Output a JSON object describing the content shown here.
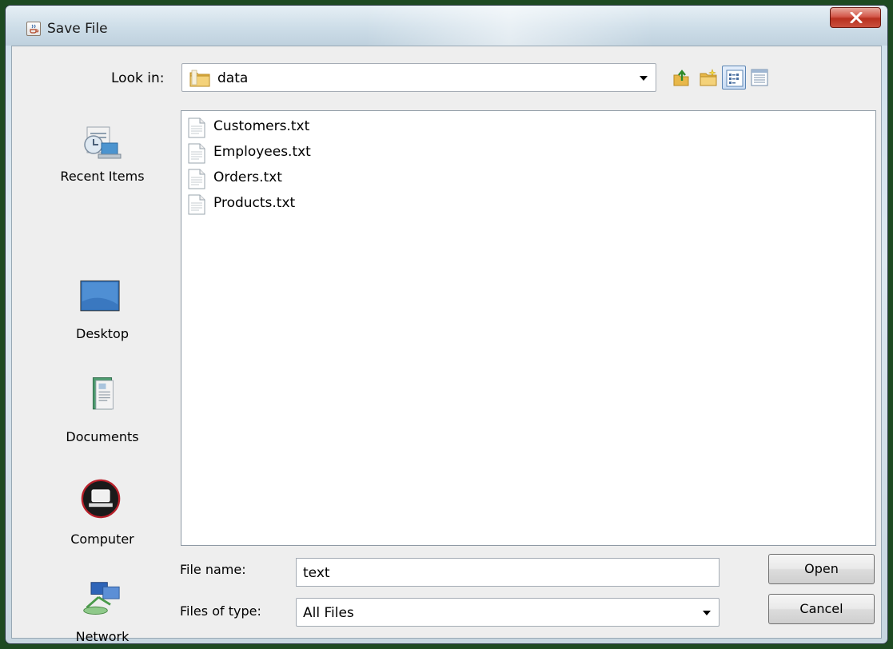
{
  "window": {
    "title": "Save File",
    "title_icon": "java-cup-icon",
    "close_icon": "close-x-icon"
  },
  "toolbar": {
    "look_in_label": "Look in:",
    "look_in_value": "data",
    "icons": [
      "up-one-level-icon",
      "create-new-folder-icon",
      "list-view-icon",
      "details-view-icon"
    ]
  },
  "places": [
    {
      "label": "Recent Items",
      "icon": "recent-items-icon"
    },
    {
      "label": "Desktop",
      "icon": "desktop-icon"
    },
    {
      "label": "Documents",
      "icon": "documents-icon"
    },
    {
      "label": "Computer",
      "icon": "computer-icon"
    },
    {
      "label": "Network",
      "icon": "network-icon"
    }
  ],
  "files": [
    {
      "name": "Customers.txt"
    },
    {
      "name": "Employees.txt"
    },
    {
      "name": "Orders.txt"
    },
    {
      "name": "Products.txt"
    }
  ],
  "form": {
    "file_name_label": "File name:",
    "file_name_value": "text",
    "files_of_type_label": "Files of type:",
    "files_of_type_value": "All Files"
  },
  "buttons": {
    "open": "Open",
    "cancel": "Cancel"
  },
  "colors": {
    "background": "#1e4a22",
    "close_button": "#c9503e",
    "selection_accent": "#5b84b3"
  }
}
